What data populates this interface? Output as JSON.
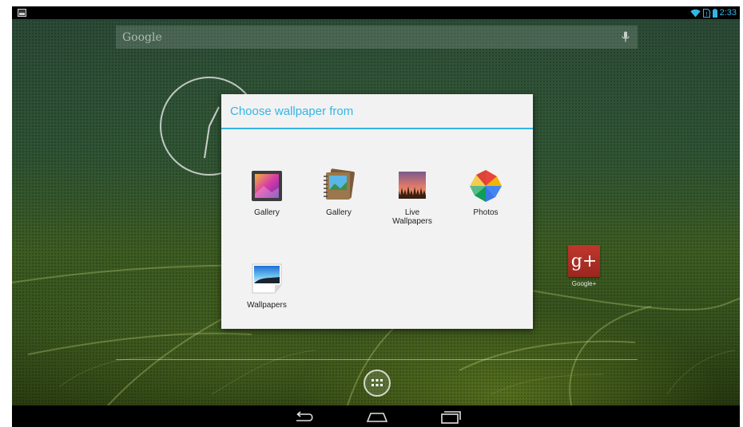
{
  "status_bar": {
    "time": "2:33",
    "icons": [
      "image-notification-icon",
      "wifi-icon",
      "no-sim-icon",
      "battery-icon"
    ]
  },
  "search": {
    "brand": "Google",
    "icon": "mic-icon"
  },
  "homescreen": {
    "shortcut_label": "Google+",
    "shortcut_icon": "google-plus-icon",
    "apps_icon": "all-apps-icon"
  },
  "dialog": {
    "title": "Choose wallpaper from",
    "options": [
      {
        "label": "Gallery",
        "icon": "gallery-icon"
      },
      {
        "label": "Gallery",
        "icon": "gallery-album-icon"
      },
      {
        "label": "Live\nWallpapers",
        "icon": "live-wallpapers-icon"
      },
      {
        "label": "Photos",
        "icon": "photos-icon"
      },
      {
        "label": "Wallpapers",
        "icon": "wallpapers-icon"
      }
    ]
  },
  "nav_bar": {
    "buttons": [
      "back-icon",
      "home-icon",
      "recents-icon"
    ]
  },
  "colors": {
    "accent": "#33b5e5",
    "dialog_bg": "#f2f2f2",
    "google_plus_red": "#c0362c"
  }
}
